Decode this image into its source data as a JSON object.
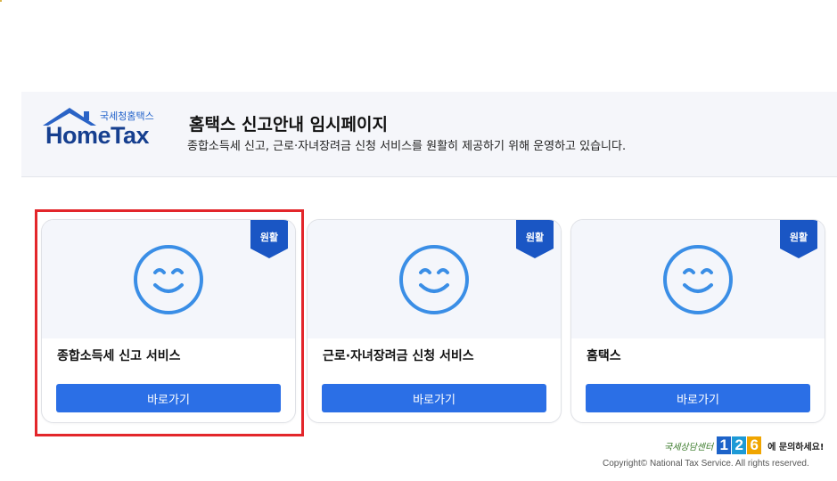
{
  "header": {
    "logo_sub": "국세청홈택스",
    "logo_word": "HomeTax",
    "title": "홈택스 신고안내 임시페이지",
    "description": "종합소득세 신고, 근로·자녀장려금 신청 서비스를 원활히 제공하기 위해 운영하고 있습니다."
  },
  "cards": [
    {
      "status": "원활",
      "title": "종합소득세 신고 서비스",
      "button_label": "바로가기",
      "icon": "smile-icon"
    },
    {
      "status": "원활",
      "title": "근로·자녀장려금 신청 서비스",
      "button_label": "바로가기",
      "icon": "smile-icon"
    },
    {
      "status": "원활",
      "title": "홈택스",
      "button_label": "바로가기",
      "icon": "smile-icon"
    }
  ],
  "footer": {
    "callcenter_name": "국세상담센터",
    "callcenter_digits": [
      "1",
      "2",
      "6"
    ],
    "callcenter_text": "에 문의하세요!",
    "copyright": "Copyright© National Tax Service. All rights reserved."
  },
  "colors": {
    "accent": "#2b6fe6",
    "badge": "#1a56c4",
    "smile": "#3a8ee6",
    "highlight": "#e3262b",
    "digit_colors": [
      "#1d63c9",
      "#1d9ad6",
      "#f0a500"
    ]
  }
}
